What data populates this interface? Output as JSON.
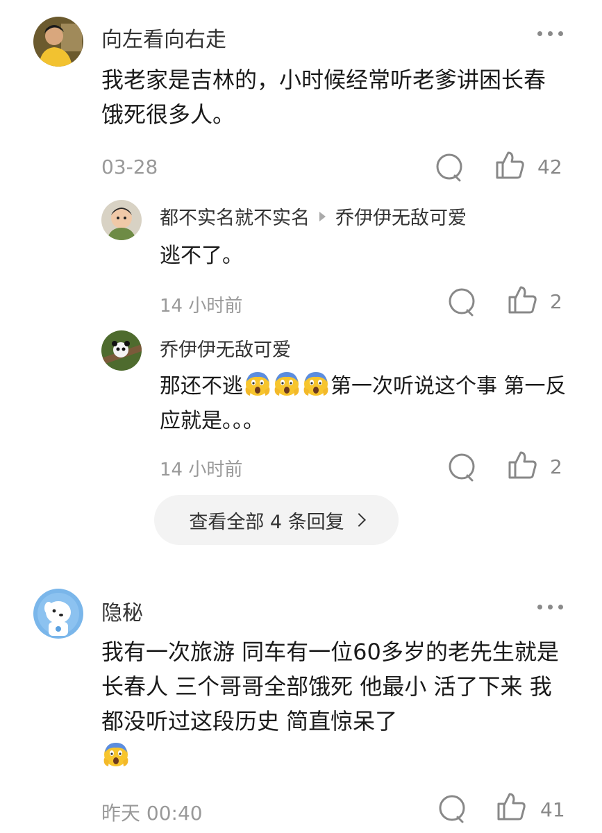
{
  "comments": [
    {
      "username": "向左看向右走",
      "text": "我老家是吉林的，小时候经常听老爹讲困长春饿死很多人。",
      "time": "03-28",
      "likes": "42",
      "avatar_icon": "person-avatar-icon",
      "replies": [
        {
          "username": "都不实名就不实名",
          "reply_to": "乔伊伊无敌可爱",
          "text": "逃不了。",
          "time": "14 小时前",
          "likes": "2",
          "avatar_icon": "baby-avatar-icon"
        },
        {
          "username": "乔伊伊无敌可爱",
          "text_part1": "那还不逃",
          "emoji": "scream-emoji",
          "text_part2": "第一次听说这个事 第一反应就是。。。",
          "time": "14 小时前",
          "likes": "2",
          "avatar_icon": "panda-avatar-icon"
        }
      ],
      "view_all_label": "查看全部 4 条回复"
    },
    {
      "username": "隐秘",
      "text": "我有一次旅游 同车有一位60多岁的老先生就是长春人 三个哥哥全部饿死 他最小 活了下来 我都没听过这段历史 简直惊呆了",
      "emoji": "scream-emoji",
      "time": "昨天 00:40",
      "likes": "41",
      "avatar_icon": "cartoon-dog-avatar-icon"
    }
  ],
  "colors": {
    "meta_gray": "#999999",
    "background": "#ffffff",
    "pill_bg": "#f3f3f3"
  }
}
